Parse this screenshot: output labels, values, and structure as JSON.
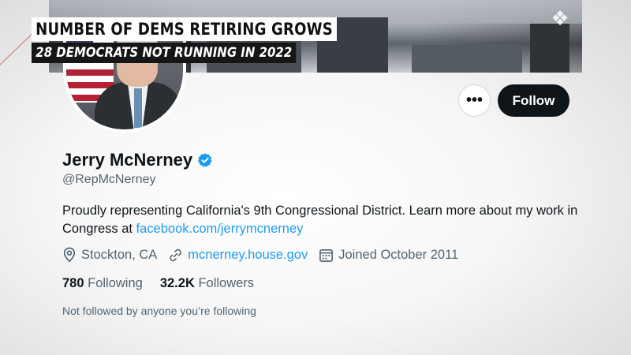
{
  "overlay": {
    "headline": "NUMBER OF DEMS RETIRING GROWS",
    "subheadline": "28 DEMOCRATS NOT RUNNING IN 2022"
  },
  "actions": {
    "more_label": "•••",
    "follow_label": "Follow"
  },
  "profile": {
    "name": "Jerry McNerney",
    "handle": "@RepMcNerney",
    "bio_text": "Proudly representing California's 9th Congressional District. Learn more about my work in Congress at ",
    "bio_link": "facebook.com/jerrymcnerney",
    "location": "Stockton, CA",
    "website": "mcnerney.house.gov",
    "joined": "Joined October 2011",
    "following_count": "780",
    "following_label": "Following",
    "followers_count": "32.2K",
    "followers_label": "Followers",
    "followed_by": "Not followed by anyone you’re following"
  },
  "colors": {
    "accent": "#1d9bf0",
    "text_primary": "#0f1419",
    "text_secondary": "#536471",
    "follow_bg": "#0f1419"
  },
  "icons": [
    "location-pin-icon",
    "link-icon",
    "calendar-icon",
    "verified-badge-icon"
  ]
}
